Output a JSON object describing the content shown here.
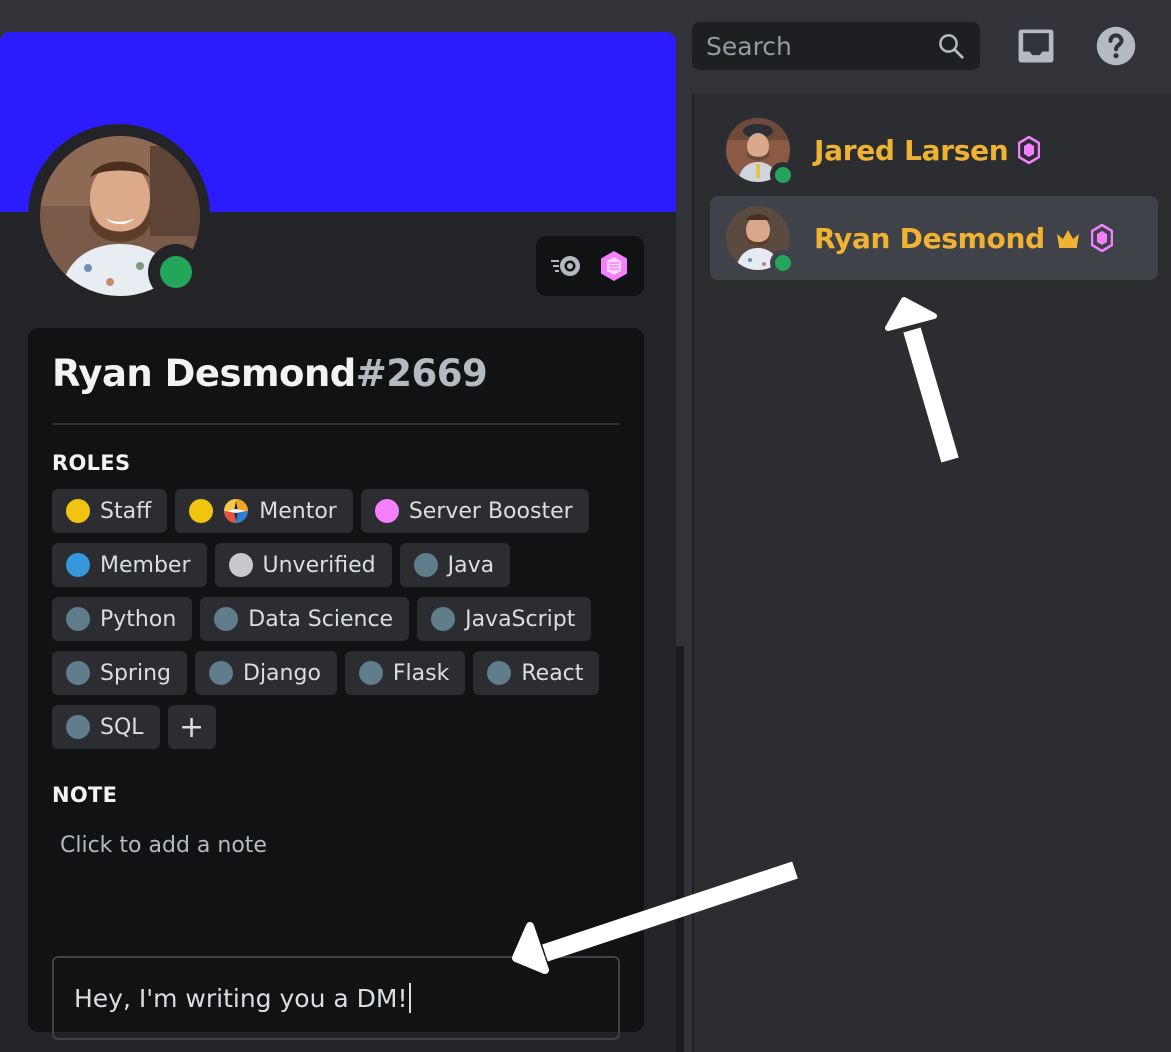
{
  "search": {
    "placeholder": "Search"
  },
  "topbar": {
    "inbox_icon": "inbox-icon",
    "help_icon": "help-icon"
  },
  "members": [
    {
      "name": "Jared Larsen",
      "badges": [
        "nitro-boost-icon"
      ],
      "status": "online",
      "name_color": "#f0b232"
    },
    {
      "name": "Ryan Desmond",
      "badges": [
        "crown-icon",
        "nitro-boost-icon"
      ],
      "status": "online",
      "name_color": "#f0b232",
      "active": true
    }
  ],
  "profile": {
    "banner_color": "#2b1cff",
    "display_name": "Ryan Desmond",
    "discriminator": "#2669",
    "status": "online",
    "badges": [
      "nitro-icon",
      "server-boost-icon"
    ],
    "roles_title": "ROLES",
    "roles": [
      {
        "label": "Staff",
        "color": "#f1c40f"
      },
      {
        "label": "Mentor",
        "color": "#f1c40f",
        "icon": "compass-icon"
      },
      {
        "label": "Server Booster",
        "color": "#f47fff"
      },
      {
        "label": "Member",
        "color": "#3498db"
      },
      {
        "label": "Unverified",
        "color": "#c7c9cc"
      },
      {
        "label": "Java",
        "color": "#607d8b"
      },
      {
        "label": "Python",
        "color": "#607d8b"
      },
      {
        "label": "Data Science",
        "color": "#607d8b"
      },
      {
        "label": "JavaScript",
        "color": "#607d8b"
      },
      {
        "label": "Spring",
        "color": "#607d8b"
      },
      {
        "label": "Django",
        "color": "#607d8b"
      },
      {
        "label": "Flask",
        "color": "#607d8b"
      },
      {
        "label": "React",
        "color": "#607d8b"
      },
      {
        "label": "SQL",
        "color": "#607d8b"
      }
    ],
    "add_role_label": "+",
    "note_title": "NOTE",
    "note_placeholder": "Click to add a note",
    "message_value": "Hey, I'm writing you a DM!"
  }
}
